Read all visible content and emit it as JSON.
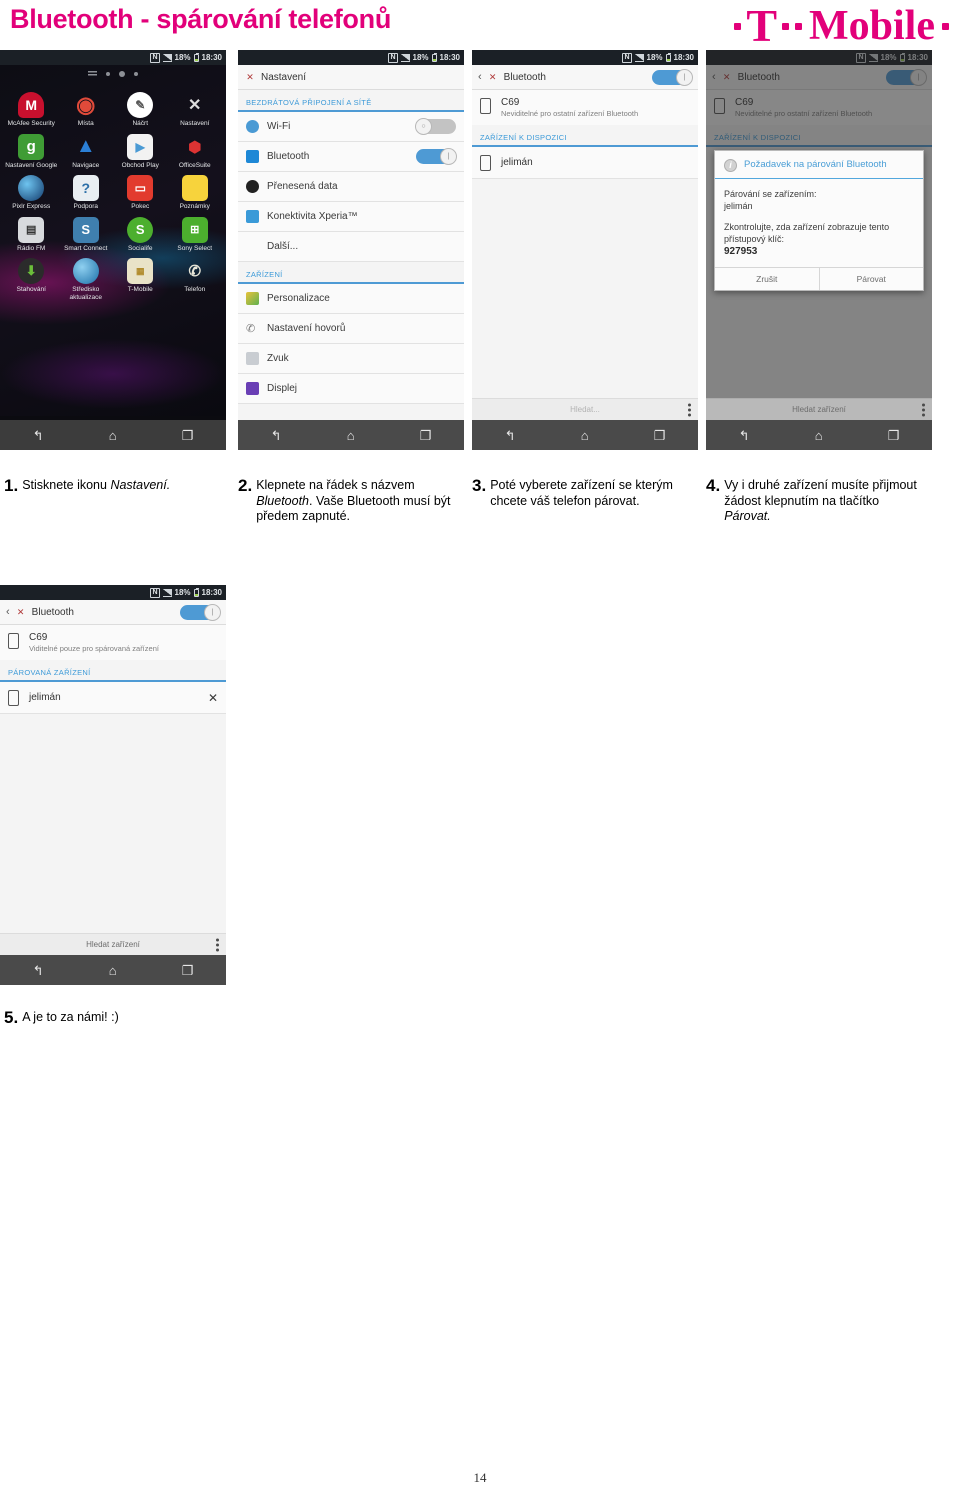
{
  "header": {
    "title": "Bluetooth - spárování telefonů",
    "brand": {
      "t": "T",
      "word": "Mobile"
    },
    "brand_color": "#e2007a"
  },
  "status_bar": {
    "nfc": "N",
    "battery_percent": "18%",
    "time": "18:30"
  },
  "nav_bar": {
    "back": "back-icon",
    "home": "home-icon",
    "recents": "recents-icon"
  },
  "screens": {
    "app_drawer": {
      "apps": [
        {
          "label": "McAfee Security",
          "icon": "mcafee-icon"
        },
        {
          "label": "Místa",
          "icon": "places-pin-icon"
        },
        {
          "label": "Náčrt",
          "icon": "sketch-icon"
        },
        {
          "label": "Nastavení",
          "icon": "settings-wrench-icon"
        },
        {
          "label": "Nastavení Google",
          "icon": "google-settings-icon"
        },
        {
          "label": "Navigace",
          "icon": "navigation-arrow-icon"
        },
        {
          "label": "Obchod Play",
          "icon": "play-store-icon"
        },
        {
          "label": "OfficeSuite",
          "icon": "officesuite-icon"
        },
        {
          "label": "Pixlr Express",
          "icon": "pixlr-icon"
        },
        {
          "label": "Podpora",
          "icon": "support-question-icon"
        },
        {
          "label": "Pokec",
          "icon": "chat-bubble-icon"
        },
        {
          "label": "Poznámky",
          "icon": "notes-icon"
        },
        {
          "label": "Rádio FM",
          "icon": "radio-icon"
        },
        {
          "label": "Smart Connect",
          "icon": "smart-connect-icon"
        },
        {
          "label": "Socialife",
          "icon": "socialife-icon"
        },
        {
          "label": "Sony Select",
          "icon": "sony-select-icon"
        },
        {
          "label": "Stahování",
          "icon": "download-icon"
        },
        {
          "label": "Středisko aktualizace",
          "icon": "update-center-icon"
        },
        {
          "label": "T-Mobile",
          "icon": "sim-card-icon"
        },
        {
          "label": "Telefon",
          "icon": "phone-handset-icon"
        }
      ]
    },
    "settings": {
      "title": "Nastavení",
      "section_wireless": "BEZDRÁTOVÁ PŘIPOJENÍ A SÍTĚ",
      "section_device": "ZAŘÍZENÍ",
      "rows_wireless": [
        {
          "label": "Wi-Fi",
          "icon": "wifi-icon",
          "toggle": "off"
        },
        {
          "label": "Bluetooth",
          "icon": "bluetooth-icon",
          "toggle": "on"
        },
        {
          "label": "Přenesená data",
          "icon": "data-usage-icon",
          "toggle": "none"
        },
        {
          "label": "Konektivita Xperia™",
          "icon": "xperia-connectivity-icon",
          "toggle": "none"
        },
        {
          "label": "Další...",
          "icon": "none",
          "toggle": "none"
        }
      ],
      "rows_device": [
        {
          "label": "Personalizace",
          "icon": "personalization-icon"
        },
        {
          "label": "Nastavení hovorů",
          "icon": "call-settings-icon"
        },
        {
          "label": "Zvuk",
          "icon": "sound-icon"
        },
        {
          "label": "Displej",
          "icon": "display-icon"
        }
      ]
    },
    "bluetooth_available": {
      "title": "Bluetooth",
      "toggle": "on",
      "my_device": {
        "name": "C69",
        "subtitle": "Neviditelné pro ostatní zařízení Bluetooth"
      },
      "section": "ZAŘÍZENÍ K DISPOZICI",
      "devices": [
        {
          "name": "jelimán"
        }
      ],
      "bottom_label": "Hledat..."
    },
    "pairing_dialog": {
      "title": "Bluetooth",
      "toggle": "on",
      "my_device": {
        "name": "C69",
        "subtitle": "Neviditelné pro ostatní zařízení Bluetooth"
      },
      "section": "ZAŘÍZENÍ K DISPOZICI",
      "dialog": {
        "title": "Požadavek na párování Bluetooth",
        "line1": "Párování se zařízením:",
        "device": "jelimán",
        "line2": "Zkontrolujte, zda zařízení zobrazuje tento přístupový klíč:",
        "passkey": "927953",
        "cancel": "Zrušit",
        "confirm": "Párovat"
      },
      "bottom_label": "Hledat zařízení"
    },
    "bluetooth_paired": {
      "title": "Bluetooth",
      "toggle": "on",
      "my_device": {
        "name": "C69",
        "subtitle": "Viditelné pouze pro spárovaná zařízení"
      },
      "section": "PÁROVANÁ ZAŘÍZENÍ",
      "devices": [
        {
          "name": "jelimán",
          "action_icon": "settings-wrench-icon"
        }
      ],
      "bottom_label": "Hledat zařízení"
    }
  },
  "steps": [
    {
      "num": "1.",
      "text_parts": [
        {
          "t": "Stisknete ikonu ",
          "i": false
        },
        {
          "t": "Nastavení.",
          "i": true
        }
      ]
    },
    {
      "num": "2.",
      "text_parts": [
        {
          "t": "Klepnete na řádek s názvem ",
          "i": false
        },
        {
          "t": "Bluetooth",
          "i": true
        },
        {
          "t": ". Vaše Bluetooth musí být předem zapnuté.",
          "i": false
        }
      ]
    },
    {
      "num": "3.",
      "text_parts": [
        {
          "t": "Poté vyberete zařízení se kterým chcete váš telefon párovat.",
          "i": false
        }
      ]
    },
    {
      "num": "4.",
      "text_parts": [
        {
          "t": "Vy i druhé zařízení musíte přijmout žádost klepnutím na tlačítko ",
          "i": false
        },
        {
          "t": "Párovat.",
          "i": true
        }
      ]
    },
    {
      "num": "5.",
      "text_parts": [
        {
          "t": "A je to za námi!   :)",
          "i": false
        }
      ]
    }
  ],
  "footer": {
    "page_number": "14"
  }
}
